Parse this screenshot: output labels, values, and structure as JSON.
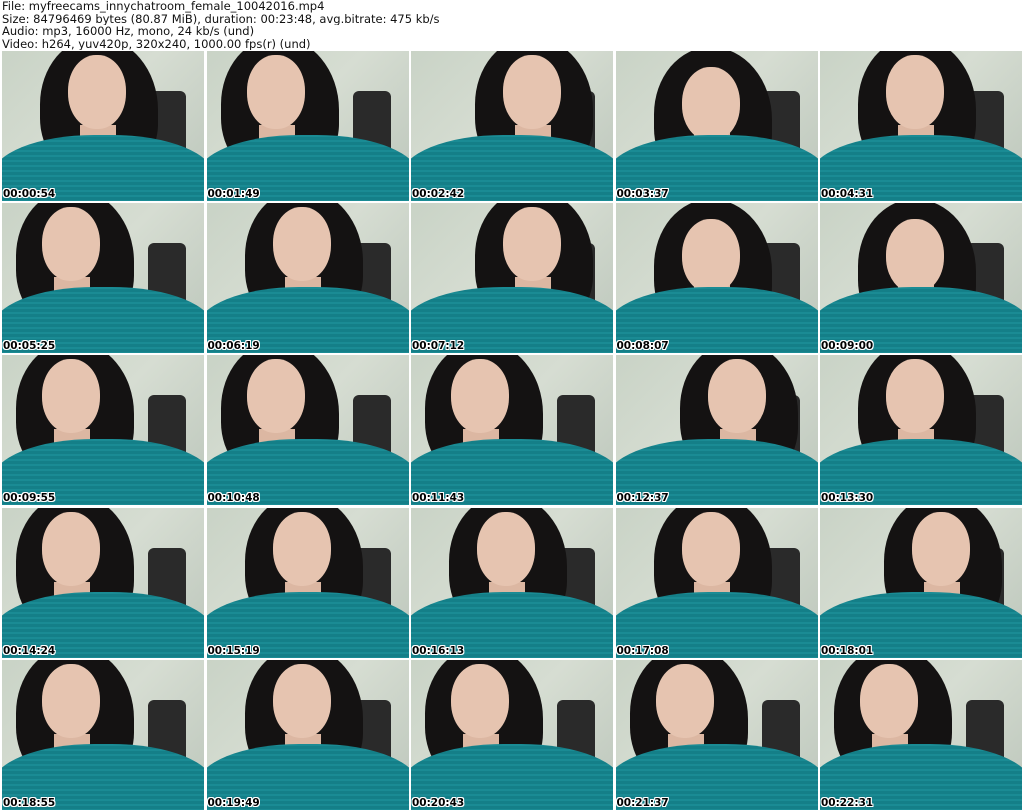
{
  "header": {
    "line1": "File: myfreecams_innychatroom_female_10042016.mp4",
    "line2": "Size: 84796469 bytes (80.87 MiB), duration: 00:23:48, avg.bitrate: 475 kb/s",
    "line3": "Audio: mp3, 16000 Hz, mono, 24 kb/s (und)",
    "line4": "Video: h264, yuv420p, 320x240, 1000.00 fps(r) (und)"
  },
  "thumbnails": [
    {
      "timestamp": "00:00:54"
    },
    {
      "timestamp": "00:01:49"
    },
    {
      "timestamp": "00:02:42"
    },
    {
      "timestamp": "00:03:37"
    },
    {
      "timestamp": "00:04:31"
    },
    {
      "timestamp": "00:05:25"
    },
    {
      "timestamp": "00:06:19"
    },
    {
      "timestamp": "00:07:12"
    },
    {
      "timestamp": "00:08:07"
    },
    {
      "timestamp": "00:09:00"
    },
    {
      "timestamp": "00:09:55"
    },
    {
      "timestamp": "00:10:48"
    },
    {
      "timestamp": "00:11:43"
    },
    {
      "timestamp": "00:12:37"
    },
    {
      "timestamp": "00:13:30"
    },
    {
      "timestamp": "00:14:24"
    },
    {
      "timestamp": "00:15:19"
    },
    {
      "timestamp": "00:16:13"
    },
    {
      "timestamp": "00:17:08"
    },
    {
      "timestamp": "00:18:01"
    },
    {
      "timestamp": "00:18:55"
    },
    {
      "timestamp": "00:19:49"
    },
    {
      "timestamp": "00:20:43"
    },
    {
      "timestamp": "00:21:37"
    },
    {
      "timestamp": "00:22:31"
    }
  ],
  "colors": {
    "sweater": "#147f88",
    "hair": "#141212",
    "background": "#c9d3c6"
  }
}
